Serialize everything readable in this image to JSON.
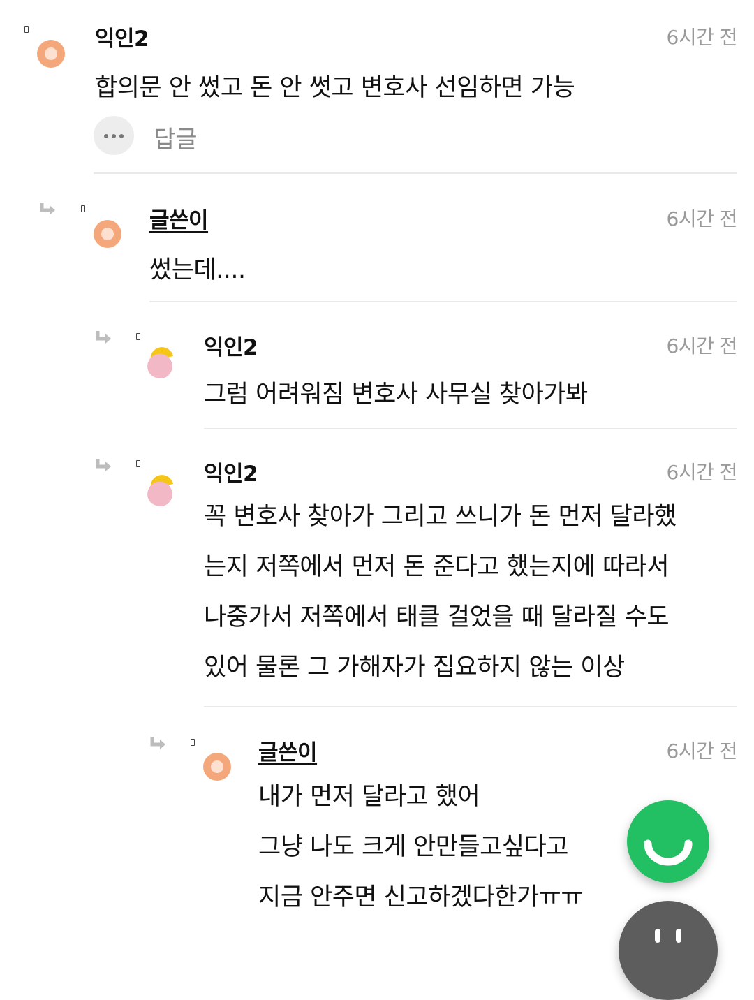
{
  "comments": [
    {
      "author": "익인2",
      "time": "6시간 전",
      "text": "합의문 안 썼고 돈 안 썻고 변호사 선임하면 가능",
      "reply_label": "답글"
    },
    {
      "author": "글쓴이",
      "time": "6시간 전",
      "text": "썼는데...."
    },
    {
      "author": "익인2",
      "time": "6시간 전",
      "text": "그럼 어려워짐 변호사 사무실 찾아가봐"
    },
    {
      "author": "익인2",
      "time": "6시간 전",
      "lines": [
        "꼭 변호사 찾아가 그리고 쓰니가 돈 먼저 달라했",
        "는지 저쪽에서 먼저 돈 준다고 했는지에 따라서",
        "나중가서 저쪽에서 태클 걸었을 때 달라질 수도",
        "있어 물론 그 가해자가 집요하지 않는 이상"
      ]
    },
    {
      "author": "글쓴이",
      "time": "6시간 전",
      "lines": [
        "내가 먼저 달라고 했어",
        "그냥 나도 크게 안만들고싶다고",
        "지금 안주면 신고하겠다한가ㅠㅠ"
      ]
    }
  ],
  "icons": {
    "reply_arrow": "reply-arrow-icon",
    "more": "more-icon",
    "fab_green": "smile-icon"
  },
  "colors": {
    "fab_green": "#22c063",
    "avatar_orange": "#f4a77a",
    "avatar_yellow": "#f5c518",
    "avatar_pink": "#f2b8c6",
    "time_gray": "#9a9a9a"
  }
}
